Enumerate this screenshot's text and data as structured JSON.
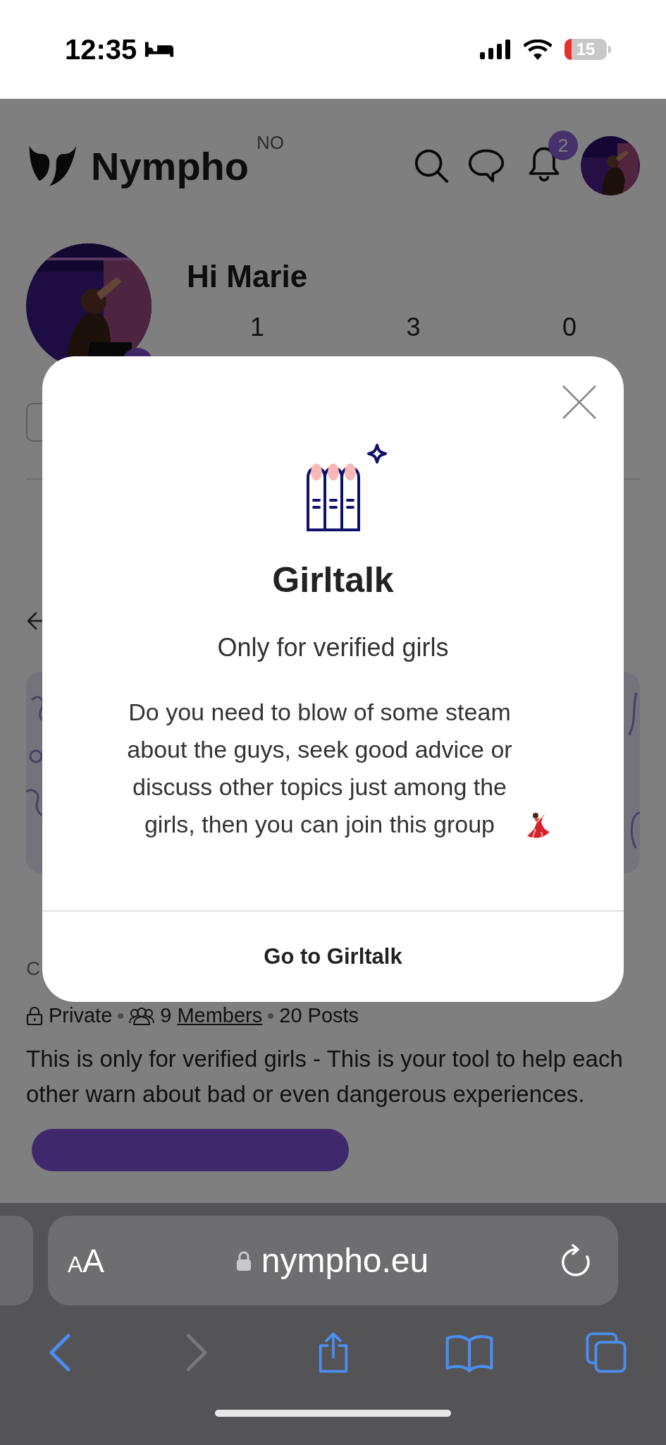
{
  "status_bar": {
    "time": "12:35",
    "battery": "15"
  },
  "header": {
    "logo": "Nympho",
    "region": "NO",
    "notification_count": "2"
  },
  "profile": {
    "greeting": "Hi Marie",
    "stats": [
      {
        "value": "1"
      },
      {
        "value": "3"
      },
      {
        "value": "0"
      }
    ]
  },
  "group": {
    "subtitle": "C",
    "privacy": "Private",
    "member_count": "9",
    "members_link": "Members",
    "posts": "20 Posts",
    "description": "This is only for verified girls - This is your tool to help each other warn about bad or even dangerous experiences."
  },
  "modal": {
    "title": "Girltalk",
    "subtitle": "Only for verified girls",
    "body": "Do you need to blow of some steam about the guys, seek good advice or discuss other topics just among the girls, then you can join this group",
    "button": "Go to Girltalk"
  },
  "browser": {
    "text_size": "AA",
    "url": "nympho.eu"
  }
}
